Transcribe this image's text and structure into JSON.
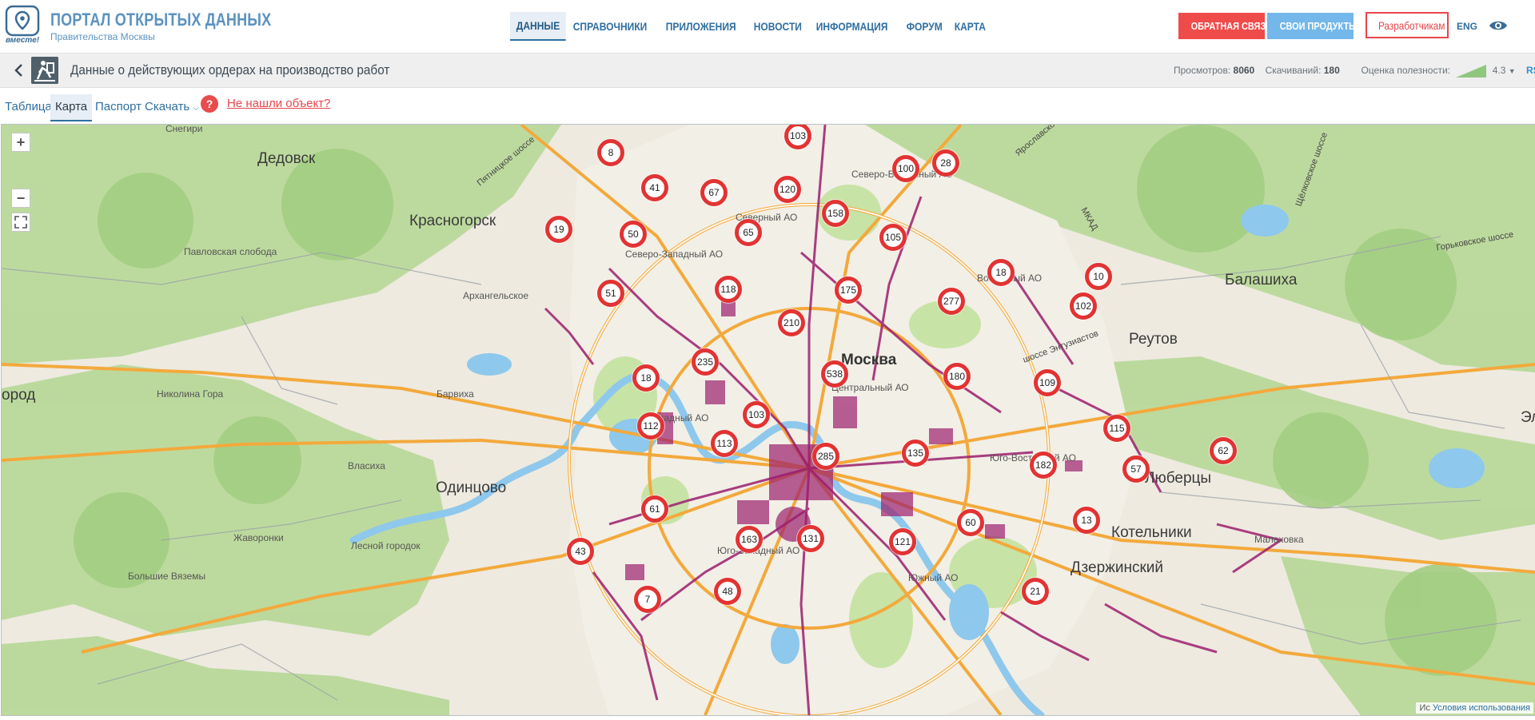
{
  "header": {
    "logo_caption": "вместе!",
    "title": "ПОРТАЛ ОТКРЫТЫХ ДАННЫХ",
    "subtitle": "Правительства Москвы",
    "nav": [
      "ДАННЫЕ",
      "СПРАВОЧНИКИ",
      "ПРИЛОЖЕНИЯ",
      "НОВОСТИ",
      "ИНФОРМАЦИЯ",
      "ФОРУМ",
      "КАРТА"
    ],
    "feedback_label": "ОБРАТНАЯ СВЯЗЬ",
    "products_label": "СВОИ ПРОДУКТЫ!",
    "developers_label": "Разработчикам",
    "lang_label": "ENG"
  },
  "dataset": {
    "title": "Данные о действующих ордерах на производство работ",
    "views_label": "Просмотров:",
    "views": "8060",
    "downloads_label": "Скачиваний:",
    "downloads": "180",
    "rating_label": "Оценка полезности:",
    "rating": "4.3",
    "rss_label": "RSS"
  },
  "tabs": {
    "table": "Таблица",
    "map": "Карта",
    "passport": "Паспорт",
    "download": "Скачать",
    "help_mark": "?",
    "not_found": "Не нашли объект?"
  },
  "map": {
    "zoom_in": "+",
    "zoom_out": "−",
    "attribution_cut": "Ис",
    "terms_label": "Условия использования",
    "places": {
      "dedovsk": "Дедовск",
      "snegiri": "Снегири",
      "krasnogorsk": "Красногорск",
      "pavlovskaya": "Павловская слобода",
      "arkhangelskoe": "Архангельское",
      "gorod": "ород",
      "nikolina": "Николина Гора",
      "barvikha": "Барвиха",
      "vlasikha": "Власиха",
      "odintsovo": "Одинцово",
      "zhavoronki": "Жаворонки",
      "lesnoy": "Лесной городок",
      "vyazemy": "Большие Вяземы",
      "balashikha": "Балашиха",
      "reutov": "Реутов",
      "lyubertsy": "Люберцы",
      "kotelniki": "Котельники",
      "malakhovka": "Малаховка",
      "dzerzhinsky": "Дзержинский",
      "moskva": "Москва",
      "el": "Эл",
      "yuzao": "Юго-Западный АО",
      "yuao": "Южный АО",
      "yuvao": "Юго-Восточный АО",
      "cao": "Центральный АО",
      "zao": "Западный АО",
      "szao": "Северо-Западный АО",
      "sao": "Северный АО",
      "svao": "Северо-Восточный АО",
      "vao": "Восточный АО",
      "pyatnitskoe": "Пятницкое шоссе",
      "yaroslavskoe": "Ярославское",
      "schelkovskoe": "Щёлковское шоссе",
      "gorkovskoe": "Горьковское шоссе",
      "mkad": "МКАД",
      "entuziastov": "шоссе Энтузиастов"
    },
    "clusters": [
      "8",
      "103",
      "41",
      "67",
      "120",
      "100",
      "28",
      "19",
      "50",
      "65",
      "158",
      "105",
      "51",
      "118",
      "175",
      "18",
      "277",
      "10",
      "102",
      "210",
      "235",
      "18",
      "538",
      "180",
      "109",
      "103",
      "112",
      "113",
      "285",
      "135",
      "182",
      "115",
      "57",
      "62",
      "61",
      "60",
      "13",
      "163",
      "131",
      "121",
      "43",
      "7",
      "48",
      "21"
    ]
  },
  "colors": {
    "accent": "#2f6fa0",
    "feedback": "#f04b4b",
    "products": "#74b7ea",
    "cluster_ring": "#e23333",
    "order_polygons": "#9c1f6e"
  },
  "icons": {
    "back": "chevron-left-icon",
    "dataset": "road-works-icon",
    "eye": "eye-icon",
    "help": "question-icon",
    "fullscreen": "fullscreen-icon"
  }
}
